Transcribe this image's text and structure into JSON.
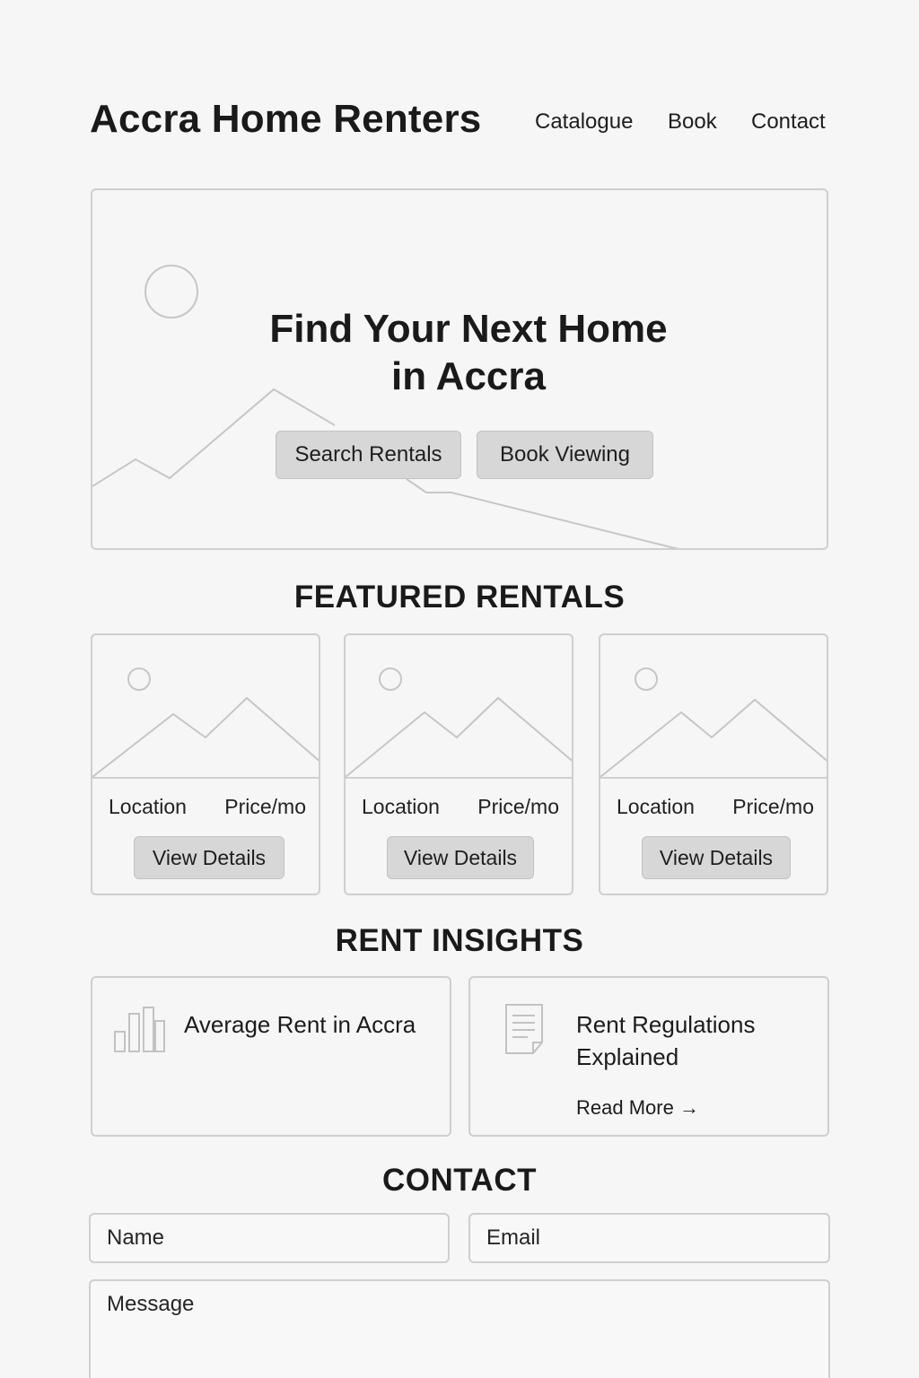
{
  "header": {
    "brand": "Accra Home Renters",
    "nav": [
      "Catalogue",
      "Book",
      "Contact"
    ]
  },
  "hero": {
    "title_line1": "Find Your Next Home",
    "title_line2": "in Accra",
    "primary_button": "Search Rentals",
    "secondary_button": "Book Viewing"
  },
  "featured": {
    "heading": "FEATURED RENTALS",
    "cards": [
      {
        "location": "Location",
        "price": "Price/mo",
        "button": "View Details"
      },
      {
        "location": "Location",
        "price": "Price/mo",
        "button": "View Details"
      },
      {
        "location": "Location",
        "price": "Price/mo",
        "button": "View Details"
      }
    ]
  },
  "insights": {
    "heading": "RENT INSIGHTS",
    "cards": [
      {
        "title": "Average Rent in Accra",
        "icon": "bar-chart-icon"
      },
      {
        "title_line1": "Rent Regulations",
        "title_line2": "Explained",
        "link": "Read More →",
        "icon": "document-icon"
      }
    ]
  },
  "contact": {
    "heading": "CONTACT",
    "name_placeholder": "Name",
    "email_placeholder": "Email",
    "message_placeholder": "Message"
  },
  "colors": {
    "background": "#f6f6f6",
    "border": "#cfcfcf",
    "button": "#d7d7d7",
    "text": "#1c1c1c"
  }
}
